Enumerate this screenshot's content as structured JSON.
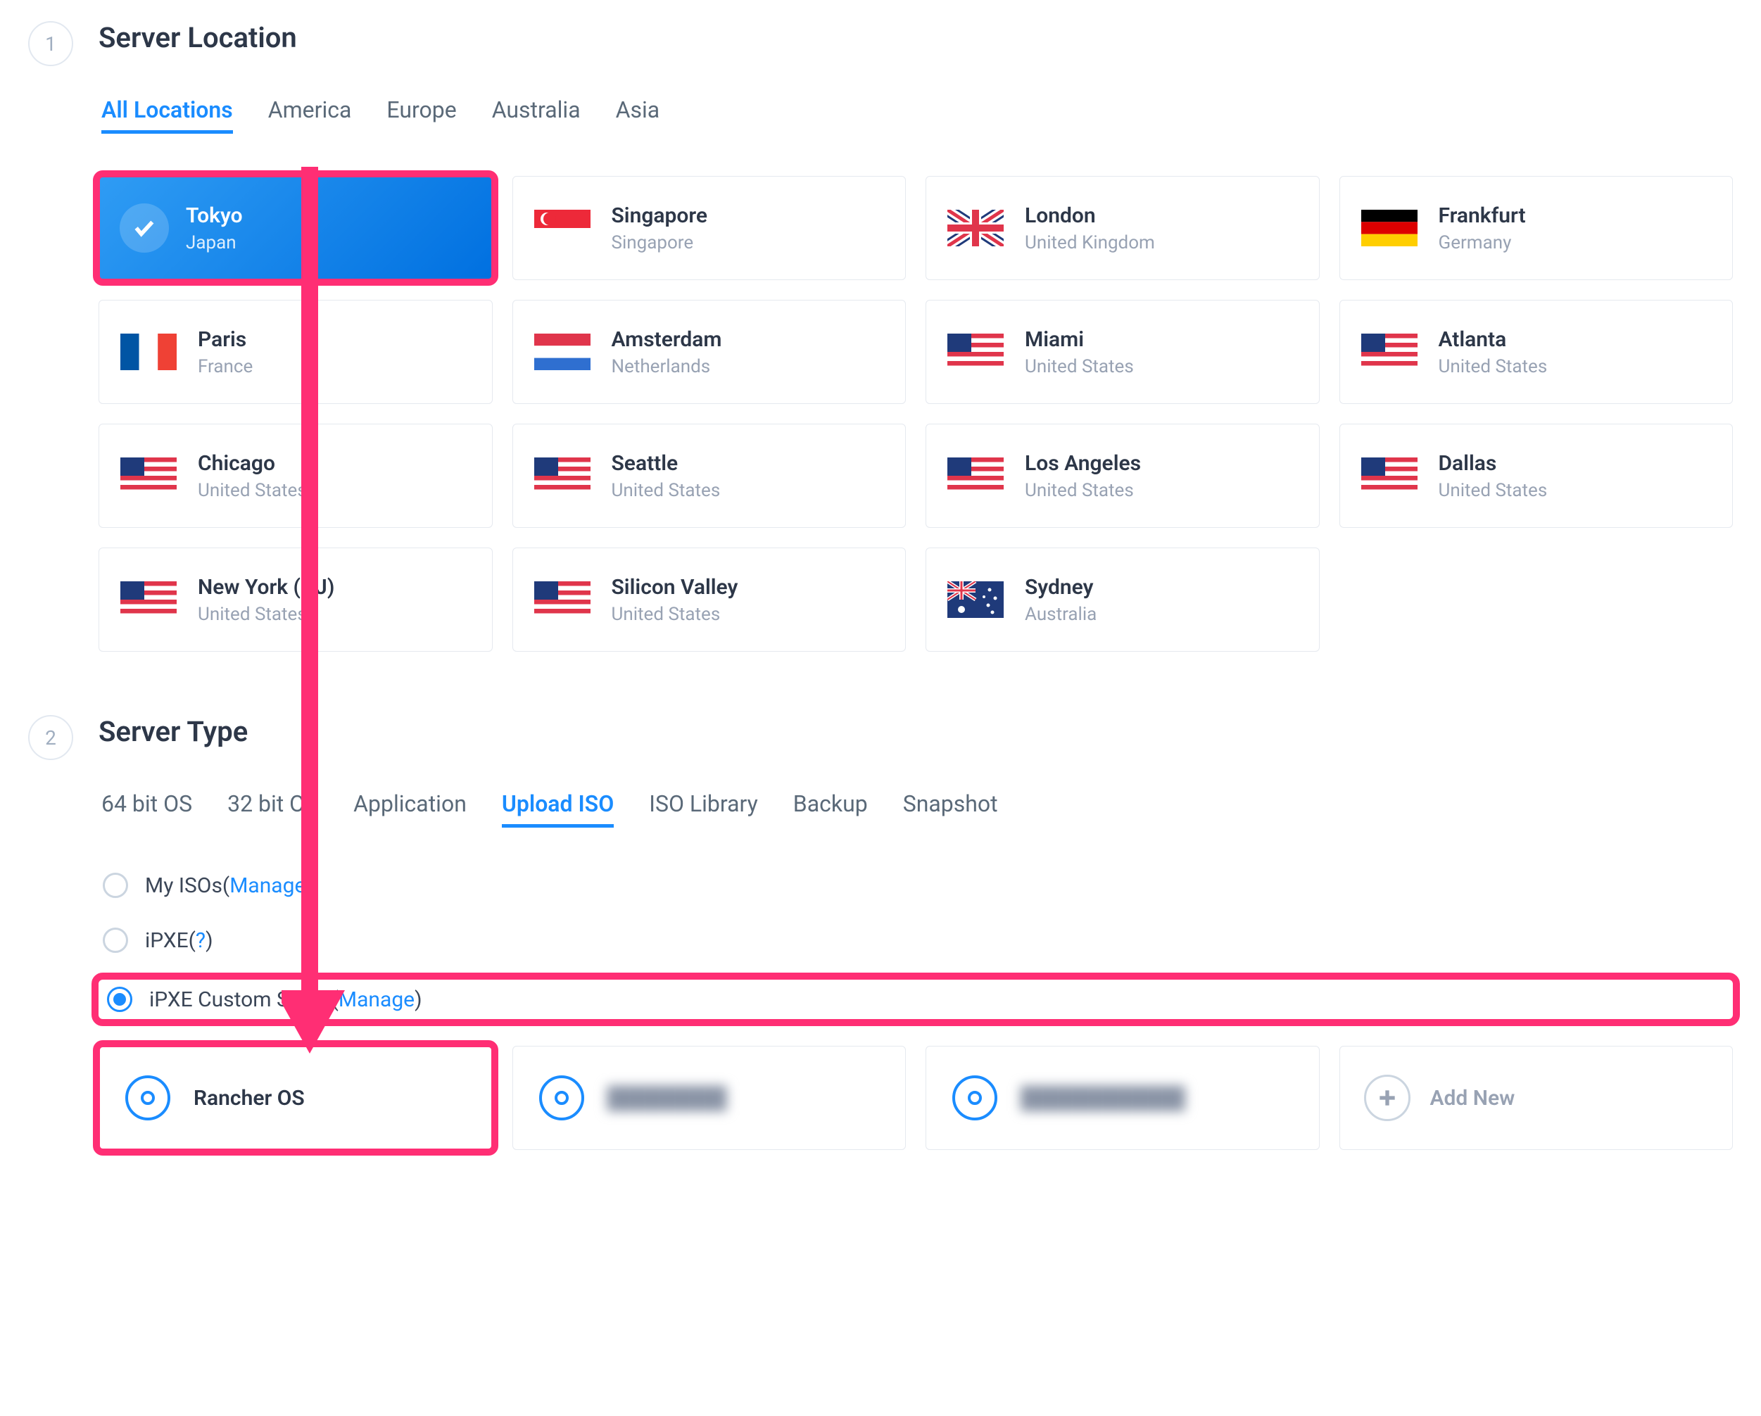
{
  "step1": {
    "number": "1",
    "title": "Server Location",
    "tabs": [
      "All Locations",
      "America",
      "Europe",
      "Australia",
      "Asia"
    ],
    "active_tab": 0,
    "locations": [
      {
        "city": "Tokyo",
        "country": "Japan",
        "flag": "jp",
        "selected": true
      },
      {
        "city": "Singapore",
        "country": "Singapore",
        "flag": "sg"
      },
      {
        "city": "London",
        "country": "United Kingdom",
        "flag": "gb"
      },
      {
        "city": "Frankfurt",
        "country": "Germany",
        "flag": "de"
      },
      {
        "city": "Paris",
        "country": "France",
        "flag": "fr"
      },
      {
        "city": "Amsterdam",
        "country": "Netherlands",
        "flag": "nl"
      },
      {
        "city": "Miami",
        "country": "United States",
        "flag": "us"
      },
      {
        "city": "Atlanta",
        "country": "United States",
        "flag": "us"
      },
      {
        "city": "Chicago",
        "country": "United States",
        "flag": "us"
      },
      {
        "city": "Seattle",
        "country": "United States",
        "flag": "us"
      },
      {
        "city": "Los Angeles",
        "country": "United States",
        "flag": "us"
      },
      {
        "city": "Dallas",
        "country": "United States",
        "flag": "us"
      },
      {
        "city": "New York (NJ)",
        "country": "United States",
        "flag": "us"
      },
      {
        "city": "Silicon Valley",
        "country": "United States",
        "flag": "us"
      },
      {
        "city": "Sydney",
        "country": "Australia",
        "flag": "au"
      }
    ]
  },
  "step2": {
    "number": "2",
    "title": "Server Type",
    "tabs": [
      "64 bit OS",
      "32 bit OS",
      "Application",
      "Upload ISO",
      "ISO Library",
      "Backup",
      "Snapshot"
    ],
    "active_tab": 3,
    "options": {
      "my_isos": {
        "label": "My ISOs",
        "paren_prefix": " ( ",
        "link": "Manage",
        "paren_suffix": " )"
      },
      "ipxe": {
        "label": "iPXE",
        "paren_prefix": " ( ",
        "link": "?",
        "paren_suffix": " )"
      },
      "ipxe_custom": {
        "label": "iPXE Custom Script",
        "paren_prefix": " ( ",
        "link": "Manage",
        "paren_suffix": " )"
      }
    },
    "selected_option": "ipxe_custom",
    "isos": [
      {
        "label": "Rancher OS",
        "blur": false
      },
      {
        "label": "████████",
        "blur": true
      },
      {
        "label": "███████████",
        "blur": true
      }
    ],
    "add_new_label": "Add New"
  }
}
